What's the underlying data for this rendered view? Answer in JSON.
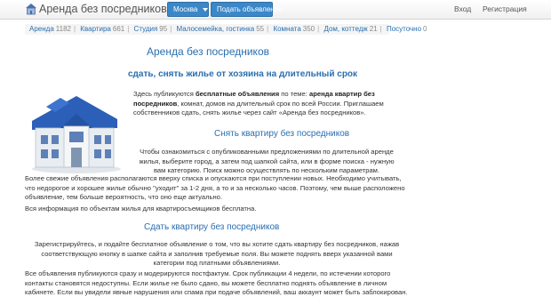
{
  "header": {
    "brand": "Аренда без посредников",
    "city_button": "Москва",
    "post_button": "Подать объявление",
    "login": "Вход",
    "register": "Регистрация"
  },
  "categories": [
    {
      "label": "Аренда",
      "count": "1182"
    },
    {
      "label": "Квартира",
      "count": "661"
    },
    {
      "label": "Студия",
      "count": "95"
    },
    {
      "label": "Малосемейка, гостинка",
      "count": "55"
    },
    {
      "label": "Комната",
      "count": "350"
    },
    {
      "label": "Дом, коттедж",
      "count": "21"
    },
    {
      "label": "Посуточно",
      "count": "0"
    }
  ],
  "content": {
    "title": "Аренда без посредников",
    "subtitle": "сдать, снять жилье от хозяина на длительный срок",
    "intro_pre": "Здесь публикуются ",
    "intro_bold1": "бесплатные объявления",
    "intro_mid": " по теме: ",
    "intro_bold2": "аренда квартир без посредников",
    "intro_post": ", комнат, домов на длительный срок по всей России. Приглашаем собственников сдать, снять жилье через сайт «Аренда без посредников».",
    "rent_heading": "Снять квартиру без посредников",
    "rent_text": "Чтобы ознакомиться с опубликованными предложениями по длительной аренде жилья, выберите город, а затем под шапкой сайта, или в форме поиска - нужную вам категорию. Поиск можно осуществлять по нескольким параметрам.",
    "fresh_text": "Более свежие объявления располагаются вверху списка и опускаются при поступлении новых. Необходимо учитывать, что недорогое и хорошее жилье обычно \"уходит\" за 1-2 дня, а то и за несколько часов. Поэтому, чем выше расположено объявление, тем больше вероятность, что оно еще актуально.",
    "free_text": "Вся информация по объектам жилья для квартиросъемщиков бесплатна.",
    "give_heading": "Сдать квартиру без посредников",
    "give_text": "Зарегистрируйтесь, и подайте бесплатное объявление о том, что вы хотите сдать квартиру без посредников, нажав соответствующую кнопку в шапке сайта и заполнив требуемые поля. Вы можете поднять вверх указанной вами категории под платными объявлениями.",
    "moderation_text": "Все объявления публикуются сразу и модерируются постфактум. Срок публикации 4 недели, по истечении которого контакты становятся недоступны. Если жилье не было сдано, вы можете бесплатно поднять объявление в личном кабинете. Если вы увидели явные нарушения или спама при подаче объявлений, ваш аккаунт может быть заблокирован."
  }
}
